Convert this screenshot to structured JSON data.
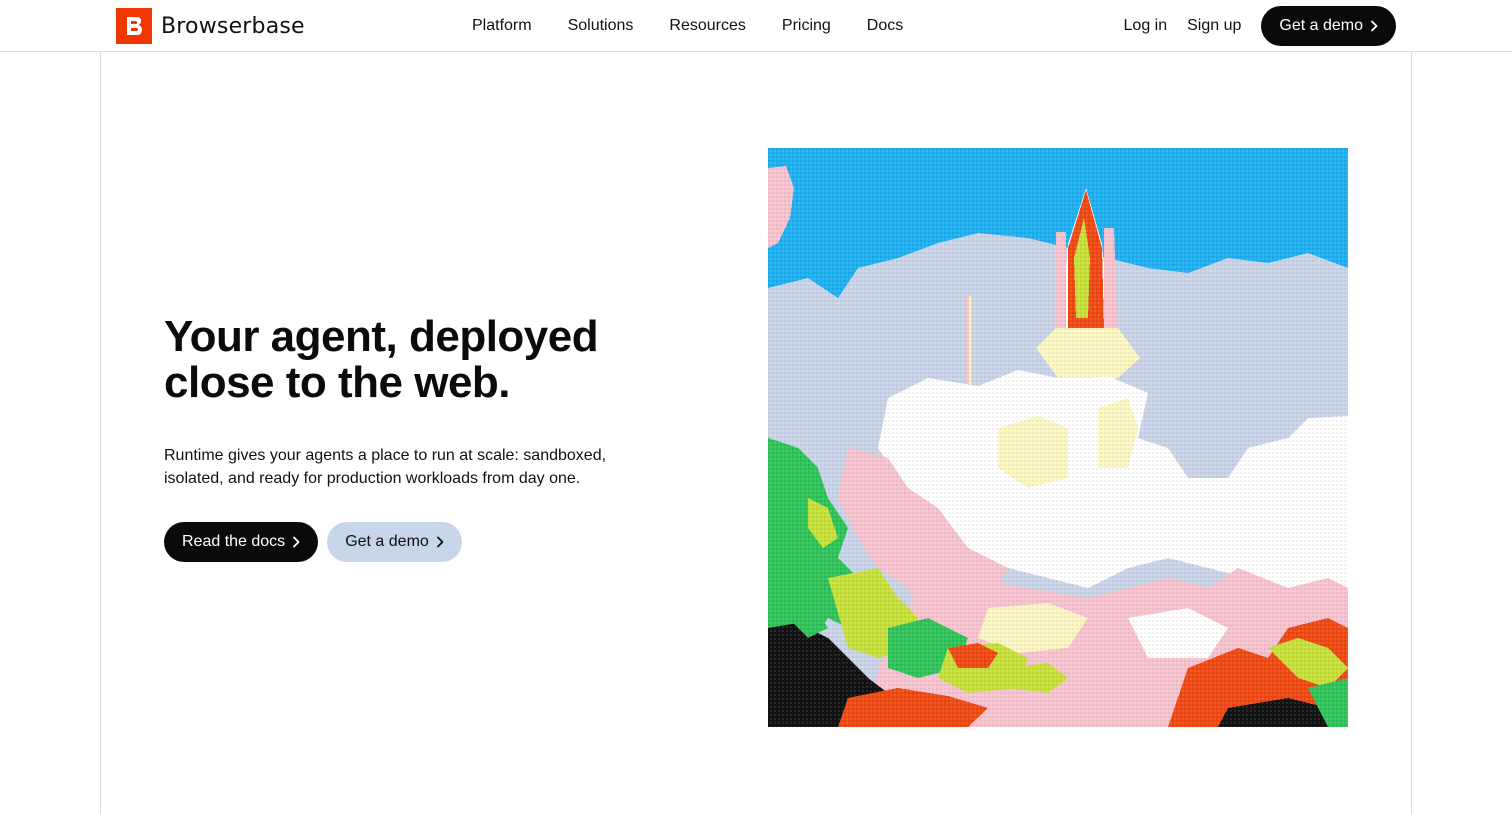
{
  "brand": {
    "name": "Browserbase",
    "logo_letter": "B",
    "accent_color": "#f03603"
  },
  "nav": {
    "items": [
      {
        "label": "Platform"
      },
      {
        "label": "Solutions"
      },
      {
        "label": "Resources"
      },
      {
        "label": "Pricing"
      },
      {
        "label": "Docs"
      }
    ]
  },
  "auth": {
    "login_label": "Log in",
    "signup_label": "Sign up",
    "demo_label": "Get a demo"
  },
  "hero": {
    "headline_line1": "Your agent, deployed",
    "headline_line2": "close to the web.",
    "subtext": "Runtime gives your agents a place to run at scale: sandboxed, isolated, and ready for production workloads from day one.",
    "primary_cta": "Read the docs",
    "secondary_cta": "Get a demo",
    "image": {
      "subject": "pixelated space shuttle launch",
      "colors": {
        "sky": "#1fb0f2",
        "smoke": "#c9d4e8",
        "cloud": "#ffffff",
        "pink": "#f7c3cf",
        "yellow": "#fbf6c2",
        "green": "#2fc35a",
        "lime": "#c7e03a",
        "orange": "#f04a14",
        "dark": "#121212"
      }
    }
  },
  "icons": {
    "chevron": "chevron-right-icon"
  }
}
